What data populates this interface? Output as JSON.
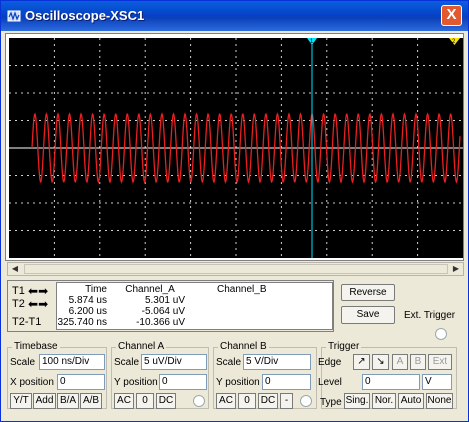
{
  "window": {
    "title": "Oscilloscope-XSC1",
    "close_label": "X"
  },
  "cursors": {
    "t1_label": "T1",
    "t2_label": "T2",
    "t2t1_label": "T2-T1",
    "header": {
      "time": "Time",
      "channel_a": "Channel_A",
      "channel_b": "Channel_B"
    },
    "rows": [
      {
        "time": "5.874 us",
        "a": "5.301 uV",
        "b": ""
      },
      {
        "time": "6.200 us",
        "a": "-5.064 uV",
        "b": ""
      },
      {
        "time": "325.740 ns",
        "a": "-10.366 uV",
        "b": ""
      }
    ]
  },
  "buttons": {
    "reverse": "Reverse",
    "save": "Save",
    "ext_trigger": "Ext. Trigger"
  },
  "timebase": {
    "title": "Timebase",
    "scale_label": "Scale",
    "scale": "100 ns/Div",
    "xpos_label": "X position",
    "xpos": "0",
    "modes": [
      "Y/T",
      "Add",
      "B/A",
      "A/B"
    ]
  },
  "channel_a": {
    "title": "Channel A",
    "scale_label": "Scale",
    "scale": "5 uV/Div",
    "ypos_label": "Y position",
    "ypos": "0",
    "coupling": [
      "AC",
      "0",
      "DC"
    ]
  },
  "channel_b": {
    "title": "Channel B",
    "scale_label": "Scale",
    "scale": "5  V/Div",
    "ypos_label": "Y position",
    "ypos": "0",
    "coupling": [
      "AC",
      "0",
      "DC",
      "-"
    ]
  },
  "trigger": {
    "title": "Trigger",
    "edge_label": "Edge",
    "edge_rise": "↗",
    "edge_fall": "↘",
    "sources": [
      "A",
      "B",
      "Ext"
    ],
    "level_label": "Level",
    "level": "0",
    "level_unit": "V",
    "type_label": "Type",
    "types": [
      "Sing.",
      "Nor.",
      "Auto",
      "None"
    ]
  },
  "colors": {
    "trace": "#e82020",
    "cursor1": "#00e5ff",
    "cursor2": "#ffe400",
    "grid": "#cfcfcf",
    "screen_bg": "#000000"
  }
}
